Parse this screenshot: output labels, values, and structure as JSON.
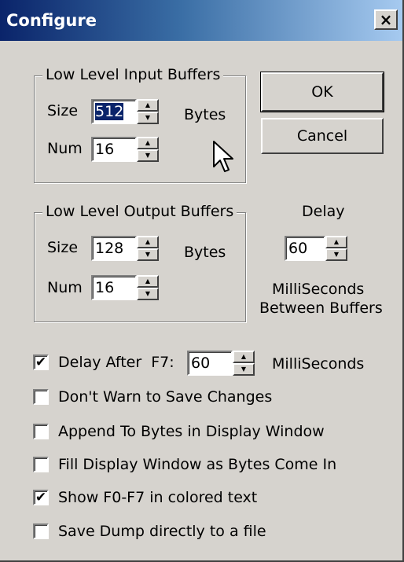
{
  "window": {
    "title": "Configure",
    "close_glyph": "×"
  },
  "input_buffers": {
    "group_label": "Low Level Input Buffers",
    "size_label": "Size",
    "size_value": "512",
    "size_unit": "Bytes",
    "num_label": "Num",
    "num_value": "16"
  },
  "output_buffers": {
    "group_label": "Low Level Output Buffers",
    "size_label": "Size",
    "size_value": "128",
    "size_unit": "Bytes",
    "num_label": "Num",
    "num_value": "16"
  },
  "buttons": {
    "ok": "OK",
    "cancel": "Cancel"
  },
  "delay": {
    "label": "Delay",
    "value": "60",
    "unit_line1": "MilliSeconds",
    "unit_line2": "Between Buffers"
  },
  "options": {
    "delay_after_label": "Delay After  F7:",
    "delay_after_value": "60",
    "delay_after_unit": "MilliSeconds",
    "delay_after_checked": true,
    "dont_warn": {
      "label": "Don't Warn to Save Changes",
      "checked": false
    },
    "append": {
      "label": "Append To Bytes in Display Window",
      "checked": false
    },
    "fill": {
      "label": "Fill Display Window as Bytes Come In",
      "checked": false
    },
    "show_f0": {
      "label": "Show F0-F7 in colored text",
      "checked": true
    },
    "save_dump": {
      "label": "Save Dump directly to a file",
      "checked": false
    }
  },
  "glyphs": {
    "up": "▲",
    "down": "▼",
    "check": "✔"
  }
}
